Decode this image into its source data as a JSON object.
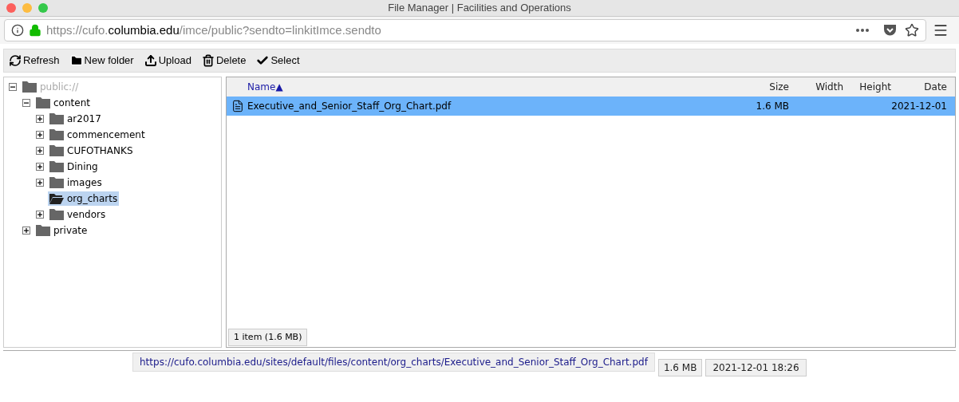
{
  "window": {
    "title": "File Manager | Facilities and Operations"
  },
  "address_bar": {
    "url_prefix": "https://cufo.",
    "url_domain": "columbia.edu",
    "url_suffix": "/imce/public?sendto=linkitImce.sendto"
  },
  "toolbar": [
    {
      "kind": "refresh",
      "label": "Refresh"
    },
    {
      "kind": "new-folder",
      "label": "New folder"
    },
    {
      "kind": "upload",
      "label": "Upload"
    },
    {
      "kind": "delete",
      "label": "Delete"
    },
    {
      "kind": "select",
      "label": "Select"
    }
  ],
  "tree": [
    {
      "label": "public://",
      "kind": "expanded",
      "selected": false,
      "disabled": true,
      "children": [
        {
          "label": "content",
          "kind": "expanded",
          "selected": false,
          "disabled": false,
          "children": [
            {
              "label": "ar2017",
              "kind": "collapsed",
              "selected": false,
              "disabled": false
            },
            {
              "label": "commencement",
              "kind": "collapsed",
              "selected": false,
              "disabled": false
            },
            {
              "label": "CUFOTHANKS",
              "kind": "collapsed",
              "selected": false,
              "disabled": false
            },
            {
              "label": "Dining",
              "kind": "collapsed",
              "selected": false,
              "disabled": false
            },
            {
              "label": "images",
              "kind": "collapsed",
              "selected": false,
              "disabled": false
            },
            {
              "label": "org_charts",
              "kind": "leaf",
              "selected": true,
              "disabled": false
            },
            {
              "label": "vendors",
              "kind": "collapsed",
              "selected": false,
              "disabled": false
            }
          ]
        },
        {
          "label": "private",
          "kind": "collapsed",
          "selected": false,
          "disabled": false
        }
      ]
    }
  ],
  "table": {
    "columns": [
      {
        "label": "Name",
        "sort_mark": "▲"
      },
      {
        "label": "Size"
      },
      {
        "label": "Width"
      },
      {
        "label": "Height"
      },
      {
        "label": "Date"
      }
    ],
    "rows": [
      {
        "name": "Executive_and_Senior_Staff_Org_Chart.pdf",
        "size": "1.6 MB",
        "date": "2021-12-01",
        "selected": true
      }
    ]
  },
  "status": "1 item (1.6 MB)",
  "preview": {
    "url": "https://cufo.columbia.edu/sites/default/files/content/org_charts/Executive_and_Senior_Staff_Org_Chart.pdf",
    "size": "1.6 MB",
    "date": "2021-12-01 18:26"
  }
}
